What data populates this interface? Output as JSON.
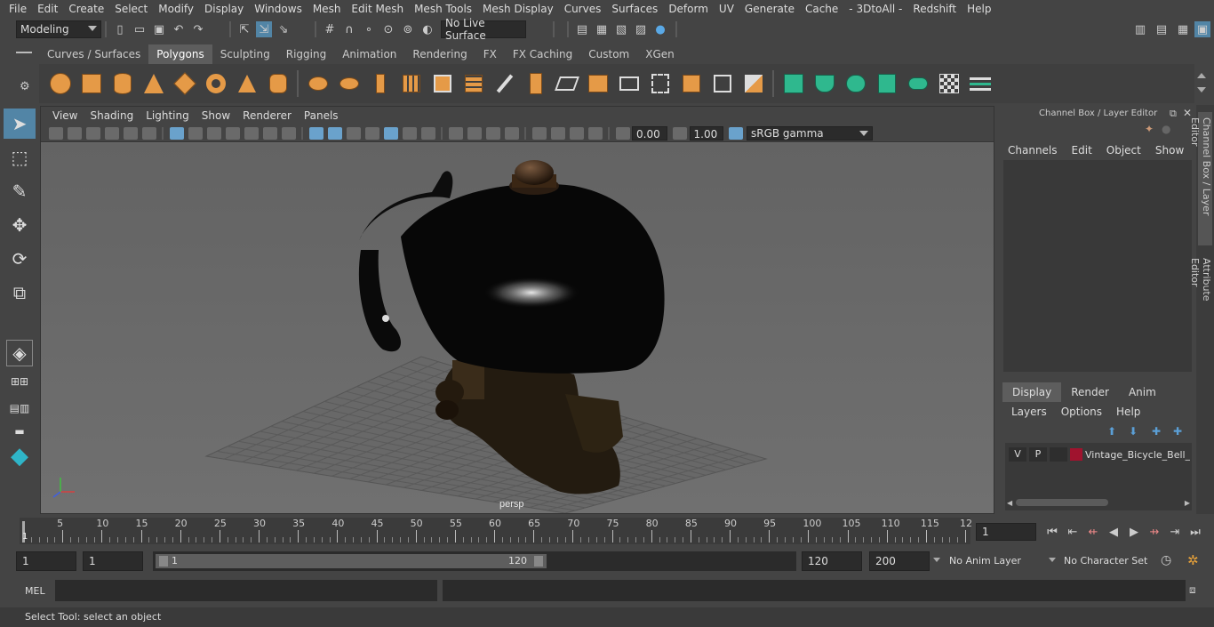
{
  "menubar": [
    "File",
    "Edit",
    "Create",
    "Select",
    "Modify",
    "Display",
    "Windows",
    "Mesh",
    "Edit Mesh",
    "Mesh Tools",
    "Mesh Display",
    "Curves",
    "Surfaces",
    "Deform",
    "UV",
    "Generate",
    "Cache",
    "- 3DtoAll -",
    "Redshift",
    "Help"
  ],
  "status": {
    "mode": "Modeling",
    "live_surface": "No Live Surface"
  },
  "shelf_tabs": [
    "Curves / Surfaces",
    "Polygons",
    "Sculpting",
    "Rigging",
    "Animation",
    "Rendering",
    "FX",
    "FX Caching",
    "Custom",
    "XGen"
  ],
  "shelf_active": "Polygons",
  "viewport": {
    "menu": [
      "View",
      "Shading",
      "Lighting",
      "Show",
      "Renderer",
      "Panels"
    ],
    "exposure": "0.00",
    "gamma": "1.00",
    "color_space": "sRGB gamma",
    "camera_label": "persp"
  },
  "channel_box": {
    "title": "Channel Box / Layer Editor",
    "menu": [
      "Channels",
      "Edit",
      "Object",
      "Show"
    ]
  },
  "layer_editor": {
    "tabs": [
      "Display",
      "Render",
      "Anim"
    ],
    "active_tab": "Display",
    "menu": [
      "Layers",
      "Options",
      "Help"
    ],
    "layers": [
      {
        "v": "V",
        "p": "P",
        "color": "#a0132e",
        "name": "Vintage_Bicycle_Bell_w"
      }
    ]
  },
  "side_tabs": [
    "Channel Box / Layer Editor",
    "Attribute Editor"
  ],
  "timeline": {
    "ticks": [
      "5",
      "10",
      "15",
      "20",
      "25",
      "30",
      "35",
      "40",
      "45",
      "50",
      "55",
      "60",
      "65",
      "70",
      "75",
      "80",
      "85",
      "90",
      "95",
      "100",
      "105",
      "110",
      "115",
      "12"
    ],
    "start_marker": "1",
    "current_frame": "1"
  },
  "range": {
    "start": "1",
    "inner_start": "1",
    "slider_start": "1",
    "slider_end": "120",
    "end": "120",
    "outer_end": "200",
    "anim_layer": "No Anim Layer",
    "character_set": "No Character Set"
  },
  "command": {
    "label": "MEL"
  },
  "help_text": "Select Tool: select an object"
}
